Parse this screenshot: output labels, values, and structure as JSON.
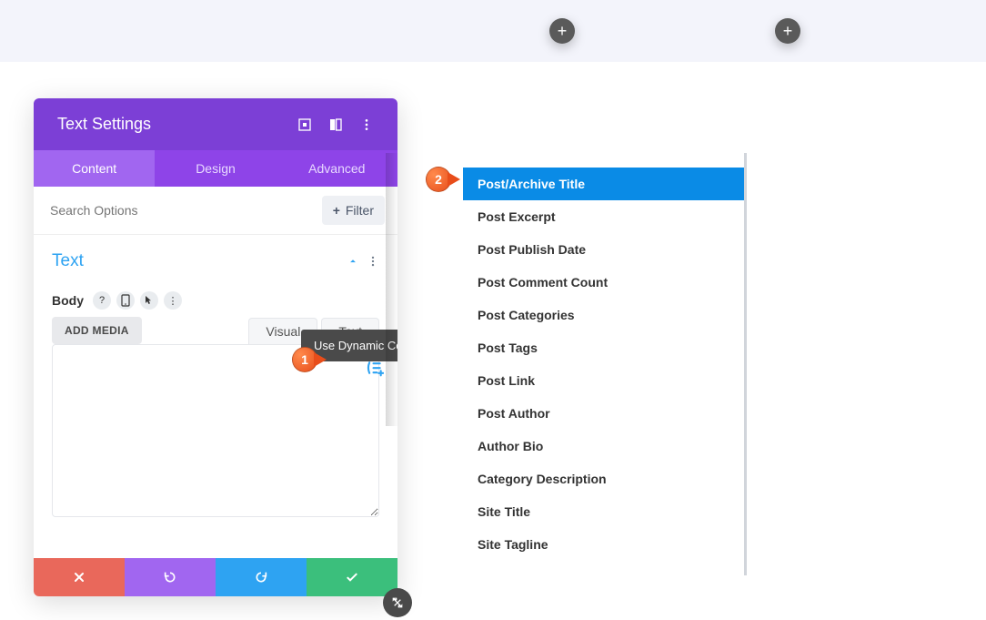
{
  "topband": {
    "plus_glyph": "+"
  },
  "panel": {
    "title": "Text Settings",
    "tabs": {
      "content": "Content",
      "design": "Design",
      "advanced": "Advanced"
    },
    "search_placeholder": "Search Options",
    "filter_label": "Filter",
    "section_title": "Text",
    "body_label": "Body",
    "add_media": "ADD MEDIA",
    "editor_tabs": {
      "visual": "Visual",
      "text": "Text"
    },
    "dynamic_tooltip": "Use Dynamic Content"
  },
  "callouts": {
    "one": "1",
    "two": "2"
  },
  "dropdown": {
    "items": [
      "Post/Archive Title",
      "Post Excerpt",
      "Post Publish Date",
      "Post Comment Count",
      "Post Categories",
      "Post Tags",
      "Post Link",
      "Post Author",
      "Author Bio",
      "Category Description",
      "Site Title",
      "Site Tagline"
    ]
  },
  "mini_icons": {
    "help": "?",
    "dots": "⋮"
  }
}
